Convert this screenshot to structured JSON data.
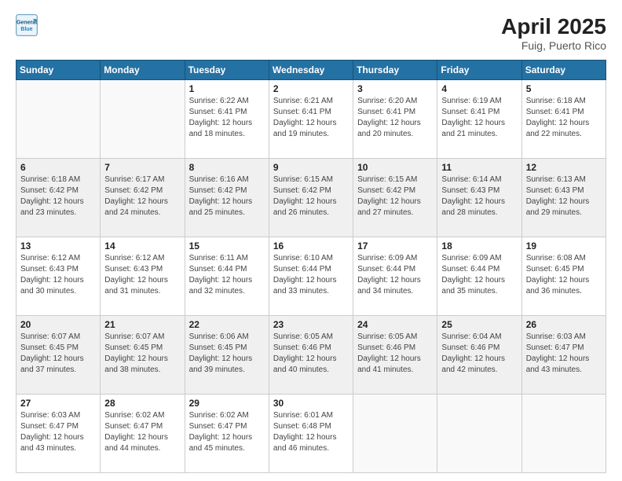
{
  "header": {
    "logo_general": "General",
    "logo_blue": "Blue",
    "month": "April 2025",
    "location": "Fuig, Puerto Rico"
  },
  "weekdays": [
    "Sunday",
    "Monday",
    "Tuesday",
    "Wednesday",
    "Thursday",
    "Friday",
    "Saturday"
  ],
  "weeks": [
    [
      {
        "day": "",
        "info": ""
      },
      {
        "day": "",
        "info": ""
      },
      {
        "day": "1",
        "info": "Sunrise: 6:22 AM\nSunset: 6:41 PM\nDaylight: 12 hours and 18 minutes."
      },
      {
        "day": "2",
        "info": "Sunrise: 6:21 AM\nSunset: 6:41 PM\nDaylight: 12 hours and 19 minutes."
      },
      {
        "day": "3",
        "info": "Sunrise: 6:20 AM\nSunset: 6:41 PM\nDaylight: 12 hours and 20 minutes."
      },
      {
        "day": "4",
        "info": "Sunrise: 6:19 AM\nSunset: 6:41 PM\nDaylight: 12 hours and 21 minutes."
      },
      {
        "day": "5",
        "info": "Sunrise: 6:18 AM\nSunset: 6:41 PM\nDaylight: 12 hours and 22 minutes."
      }
    ],
    [
      {
        "day": "6",
        "info": "Sunrise: 6:18 AM\nSunset: 6:42 PM\nDaylight: 12 hours and 23 minutes."
      },
      {
        "day": "7",
        "info": "Sunrise: 6:17 AM\nSunset: 6:42 PM\nDaylight: 12 hours and 24 minutes."
      },
      {
        "day": "8",
        "info": "Sunrise: 6:16 AM\nSunset: 6:42 PM\nDaylight: 12 hours and 25 minutes."
      },
      {
        "day": "9",
        "info": "Sunrise: 6:15 AM\nSunset: 6:42 PM\nDaylight: 12 hours and 26 minutes."
      },
      {
        "day": "10",
        "info": "Sunrise: 6:15 AM\nSunset: 6:42 PM\nDaylight: 12 hours and 27 minutes."
      },
      {
        "day": "11",
        "info": "Sunrise: 6:14 AM\nSunset: 6:43 PM\nDaylight: 12 hours and 28 minutes."
      },
      {
        "day": "12",
        "info": "Sunrise: 6:13 AM\nSunset: 6:43 PM\nDaylight: 12 hours and 29 minutes."
      }
    ],
    [
      {
        "day": "13",
        "info": "Sunrise: 6:12 AM\nSunset: 6:43 PM\nDaylight: 12 hours and 30 minutes."
      },
      {
        "day": "14",
        "info": "Sunrise: 6:12 AM\nSunset: 6:43 PM\nDaylight: 12 hours and 31 minutes."
      },
      {
        "day": "15",
        "info": "Sunrise: 6:11 AM\nSunset: 6:44 PM\nDaylight: 12 hours and 32 minutes."
      },
      {
        "day": "16",
        "info": "Sunrise: 6:10 AM\nSunset: 6:44 PM\nDaylight: 12 hours and 33 minutes."
      },
      {
        "day": "17",
        "info": "Sunrise: 6:09 AM\nSunset: 6:44 PM\nDaylight: 12 hours and 34 minutes."
      },
      {
        "day": "18",
        "info": "Sunrise: 6:09 AM\nSunset: 6:44 PM\nDaylight: 12 hours and 35 minutes."
      },
      {
        "day": "19",
        "info": "Sunrise: 6:08 AM\nSunset: 6:45 PM\nDaylight: 12 hours and 36 minutes."
      }
    ],
    [
      {
        "day": "20",
        "info": "Sunrise: 6:07 AM\nSunset: 6:45 PM\nDaylight: 12 hours and 37 minutes."
      },
      {
        "day": "21",
        "info": "Sunrise: 6:07 AM\nSunset: 6:45 PM\nDaylight: 12 hours and 38 minutes."
      },
      {
        "day": "22",
        "info": "Sunrise: 6:06 AM\nSunset: 6:45 PM\nDaylight: 12 hours and 39 minutes."
      },
      {
        "day": "23",
        "info": "Sunrise: 6:05 AM\nSunset: 6:46 PM\nDaylight: 12 hours and 40 minutes."
      },
      {
        "day": "24",
        "info": "Sunrise: 6:05 AM\nSunset: 6:46 PM\nDaylight: 12 hours and 41 minutes."
      },
      {
        "day": "25",
        "info": "Sunrise: 6:04 AM\nSunset: 6:46 PM\nDaylight: 12 hours and 42 minutes."
      },
      {
        "day": "26",
        "info": "Sunrise: 6:03 AM\nSunset: 6:47 PM\nDaylight: 12 hours and 43 minutes."
      }
    ],
    [
      {
        "day": "27",
        "info": "Sunrise: 6:03 AM\nSunset: 6:47 PM\nDaylight: 12 hours and 43 minutes."
      },
      {
        "day": "28",
        "info": "Sunrise: 6:02 AM\nSunset: 6:47 PM\nDaylight: 12 hours and 44 minutes."
      },
      {
        "day": "29",
        "info": "Sunrise: 6:02 AM\nSunset: 6:47 PM\nDaylight: 12 hours and 45 minutes."
      },
      {
        "day": "30",
        "info": "Sunrise: 6:01 AM\nSunset: 6:48 PM\nDaylight: 12 hours and 46 minutes."
      },
      {
        "day": "",
        "info": ""
      },
      {
        "day": "",
        "info": ""
      },
      {
        "day": "",
        "info": ""
      }
    ]
  ]
}
